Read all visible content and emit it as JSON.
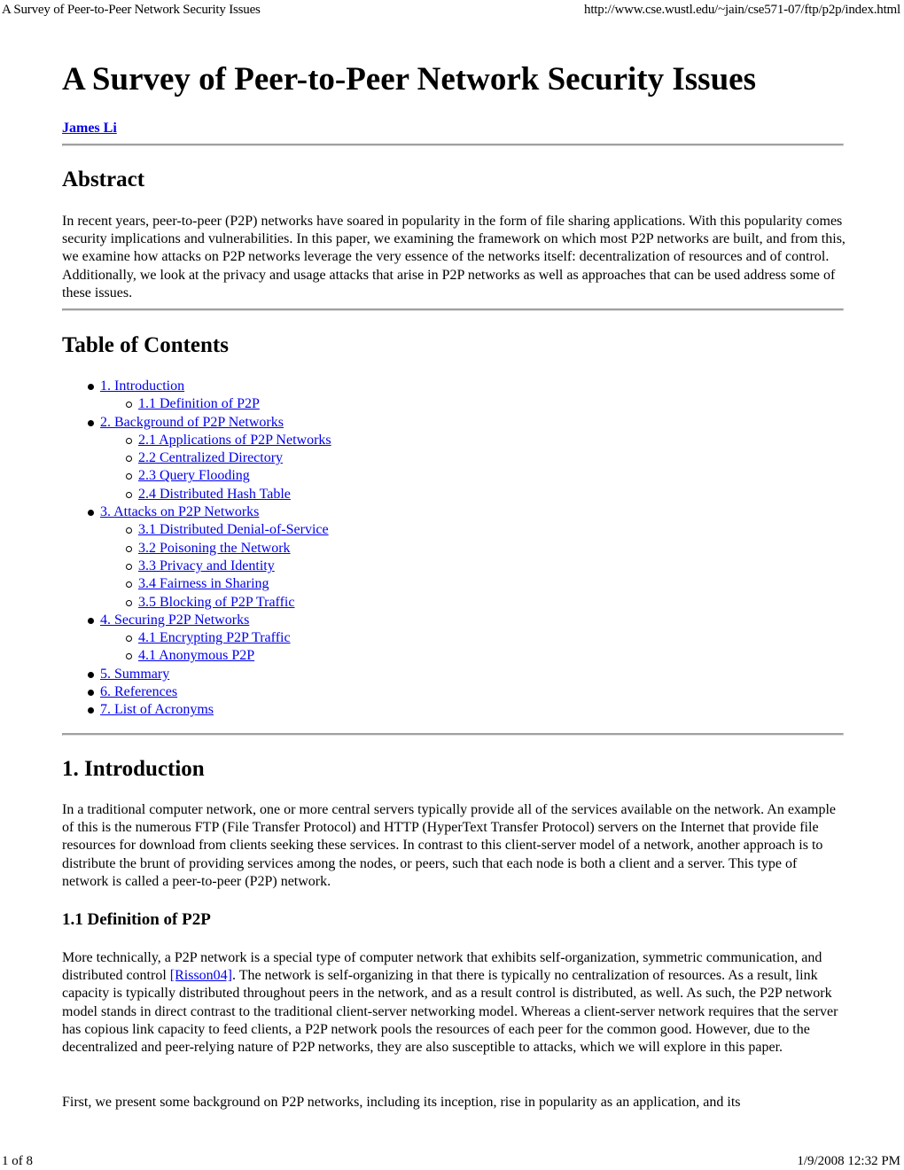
{
  "print_header": {
    "title": "A Survey of Peer-to-Peer Network Security Issues",
    "url": "http://www.cse.wustl.edu/~jain/cse571-07/ftp/p2p/index.html"
  },
  "print_footer": {
    "page": "1 of 8",
    "datetime": "1/9/2008 12:32 PM"
  },
  "document": {
    "title": "A Survey of Peer-to-Peer Network Security Issues",
    "author": "James Li",
    "abstract": {
      "heading": "Abstract",
      "text": "In recent years, peer-to-peer (P2P) networks have soared in popularity in the form of file sharing applications. With this popularity comes security implications and vulnerabilities. In this paper, we examining the framework on which most P2P networks are built, and from this, we examine how attacks on P2P networks leverage the very essence of the networks itself: decentralization of resources and of control. Additionally, we look at the privacy and usage attacks that arise in P2P networks as well as approaches that can be used address some of these issues."
    },
    "toc": {
      "heading": "Table of Contents",
      "items": [
        {
          "label": "1. Introduction",
          "children": [
            {
              "label": "1.1 Definition of P2P"
            }
          ]
        },
        {
          "label": "2. Background of P2P Networks",
          "children": [
            {
              "label": "2.1 Applications of P2P Networks"
            },
            {
              "label": "2.2 Centralized Directory"
            },
            {
              "label": "2.3 Query Flooding"
            },
            {
              "label": "2.4 Distributed Hash Table"
            }
          ]
        },
        {
          "label": "3. Attacks on P2P Networks",
          "children": [
            {
              "label": "3.1 Distributed Denial-of-Service"
            },
            {
              "label": "3.2 Poisoning the Network"
            },
            {
              "label": "3.3 Privacy and Identity"
            },
            {
              "label": "3.4 Fairness in Sharing"
            },
            {
              "label": "3.5 Blocking of P2P Traffic"
            }
          ]
        },
        {
          "label": "4. Securing P2P Networks",
          "children": [
            {
              "label": "4.1 Encrypting P2P Traffic"
            },
            {
              "label": "4.1 Anonymous P2P"
            }
          ]
        },
        {
          "label": "5. Summary",
          "children": []
        },
        {
          "label": "6. References",
          "children": []
        },
        {
          "label": "7. List of Acronyms",
          "children": []
        }
      ]
    },
    "introduction": {
      "heading": "1. Introduction",
      "text": "In a traditional computer network, one or more central servers typically provide all of the services available on the network. An example of this is the numerous FTP (File Transfer Protocol) and HTTP (HyperText Transfer Protocol) servers on the Internet that provide file resources for download from clients seeking these services. In contrast to this client-server model of a network, another approach is to distribute the brunt of providing services among the nodes, or peers, such that each node is both a client and a server. This type of network is called a peer-to-peer (P2P) network."
    },
    "definition": {
      "heading": "1.1 Definition of P2P",
      "text_before_citation": "More technically, a P2P network is a special type of computer network that exhibits self-organization, symmetric communication, and distributed control ",
      "citation": "[Risson04]",
      "text_after_citation": ". The network is self-organizing in that there is typically no centralization of resources. As a result, link capacity is typically distributed throughout peers in the network, and as a result control is distributed, as well. As such, the P2P network model stands in direct contrast to the traditional client-server networking model. Whereas a client-server network requires that the server has copious link capacity to feed clients, a P2P network pools the resources of each peer for the common good. However, due to the decentralized and peer-relying nature of P2P networks, they are also susceptible to attacks, which we will explore in this paper.",
      "next_paragraph": "First, we present some background on P2P networks, including its inception, rise in popularity as an application, and its"
    }
  },
  "colors": {
    "link": "#0000ee",
    "text": "#000000",
    "rule": "#a0a0a0"
  }
}
